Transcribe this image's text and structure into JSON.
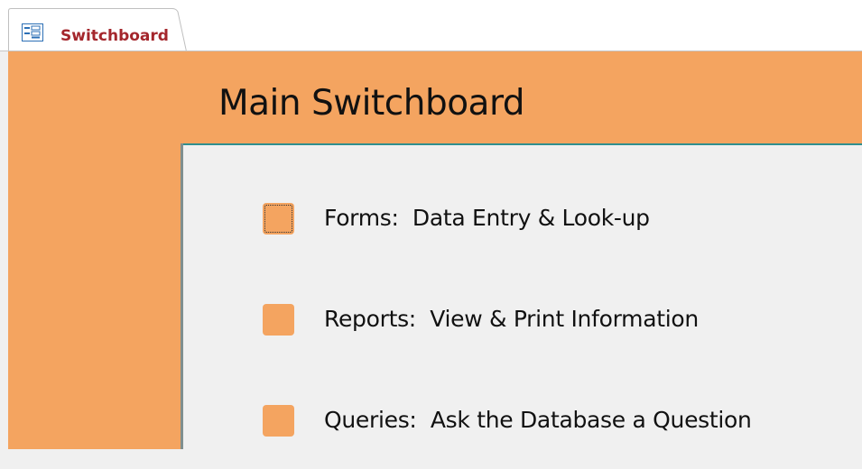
{
  "tab": {
    "label": "Switchboard",
    "icon": "form-icon",
    "label_color": "#a4262c"
  },
  "form": {
    "title": "Main Switchboard",
    "accent_color": "#f4a460",
    "detail_background": "#f0f0f0"
  },
  "switchboard_items": [
    {
      "label": "Forms:  Data Entry & Look-up",
      "focused": true
    },
    {
      "label": "Reports:  View & Print Information",
      "focused": false
    },
    {
      "label": "Queries:  Ask the Database a Question",
      "focused": false
    }
  ]
}
